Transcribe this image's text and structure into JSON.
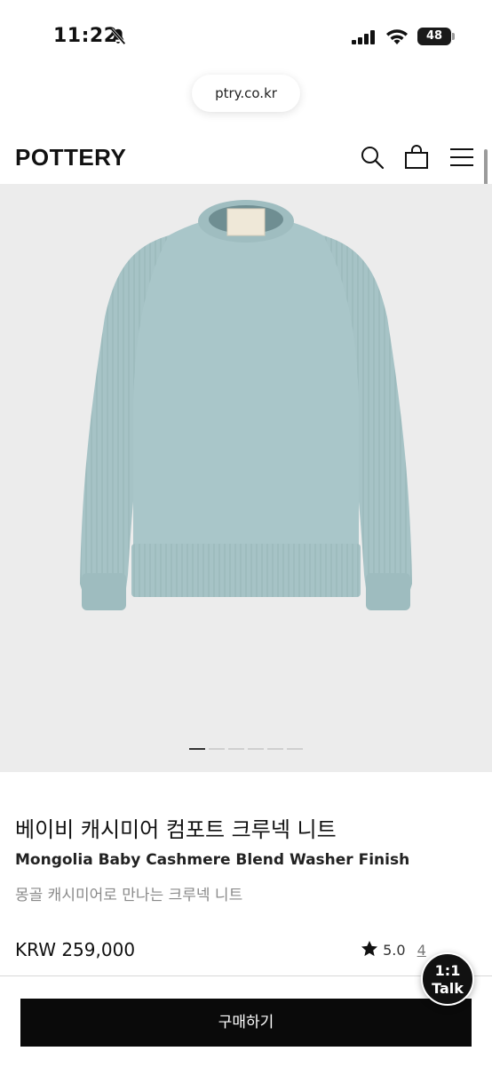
{
  "status_bar": {
    "time": "11:22",
    "battery": "48"
  },
  "browser": {
    "url": "ptry.co.kr"
  },
  "header": {
    "logo": "POTTERY"
  },
  "gallery": {
    "slide_count": 6,
    "active_index": 0
  },
  "product": {
    "title_ko": "베이비 캐시미어 컴포트 크루넥 니트",
    "title_en": "Mongolia Baby Cashmere Blend Washer Finish",
    "subtitle": "몽골 캐시미어로 만나는 크루넥 니트",
    "price": "KRW 259,000",
    "rating": "5.0",
    "rating_extra": "4"
  },
  "talk": {
    "line1": "1:1",
    "line2": "Talk"
  },
  "bottom": {
    "buy_label": "구매하기"
  },
  "colors": {
    "sweater": "#a6c3c6",
    "image_bg": "#ececec",
    "button": "#0a0a0a"
  }
}
